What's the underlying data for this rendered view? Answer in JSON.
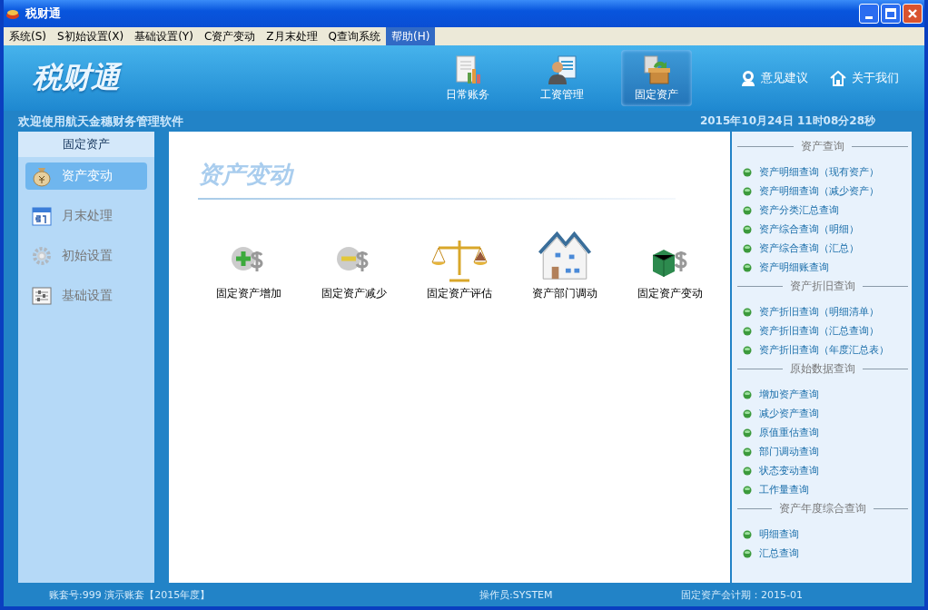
{
  "window": {
    "title": "税财通"
  },
  "menu": [
    {
      "label": "系统(S)",
      "selected": false
    },
    {
      "label": "S初始设置(X)",
      "selected": false
    },
    {
      "label": "基础设置(Y)",
      "selected": false
    },
    {
      "label": "C资产变动",
      "selected": false
    },
    {
      "label": "Z月末处理",
      "selected": false
    },
    {
      "label": "Q查询系统",
      "selected": false
    },
    {
      "label": "帮助(H)",
      "selected": true
    }
  ],
  "header": {
    "logo": "税财通",
    "modules": [
      {
        "label": "日常账务",
        "kind": "ledger",
        "selected": false
      },
      {
        "label": "工资管理",
        "kind": "payroll",
        "selected": false
      },
      {
        "label": "固定资产",
        "kind": "assets",
        "selected": true
      }
    ],
    "links": [
      {
        "label": "意见建议",
        "kind": "feedback"
      },
      {
        "label": "关于我们",
        "kind": "home"
      }
    ]
  },
  "welcome": "欢迎使用航天金穗财务管理软件",
  "datetime": "2015年10月24日  11时08分28秒",
  "sidebar": {
    "title": "固定资产",
    "items": [
      {
        "label": "资产变动",
        "kind": "moneybag",
        "selected": true
      },
      {
        "label": "月末处理",
        "kind": "calendar",
        "selected": false
      },
      {
        "label": "初始设置",
        "kind": "gear",
        "selected": false
      },
      {
        "label": "基础设置",
        "kind": "list",
        "selected": false
      }
    ]
  },
  "content": {
    "title": "资产变动",
    "actions": [
      {
        "label": "固定资产增加",
        "kind": "add"
      },
      {
        "label": "固定资产减少",
        "kind": "remove"
      },
      {
        "label": "固定资产评估",
        "kind": "scale"
      },
      {
        "label": "资产部门调动",
        "kind": "house"
      },
      {
        "label": "固定资产变动",
        "kind": "change"
      }
    ]
  },
  "queries": [
    {
      "title": "资产查询",
      "items": [
        "资产明细查询（现有资产）",
        "资产明细查询（减少资产）",
        "资产分类汇总查询",
        "资产综合查询（明细）",
        "资产综合查询（汇总）",
        "资产明细账查询"
      ]
    },
    {
      "title": "资产折旧查询",
      "items": [
        "资产折旧查询（明细清单）",
        "资产折旧查询（汇总查询）",
        "资产折旧查询（年度汇总表）"
      ]
    },
    {
      "title": "原始数据查询",
      "items": [
        "增加资产查询",
        "减少资产查询",
        "原值重估查询",
        "部门调动查询",
        "状态变动查询",
        "工作量查询"
      ]
    },
    {
      "title": "资产年度综合查询",
      "items": [
        "明细查询",
        "汇总查询"
      ]
    }
  ],
  "status": {
    "account": "账套号:999 演示账套【2015年度】",
    "operator": "操作员:SYSTEM",
    "period": "固定资产会计期：2015-01"
  }
}
